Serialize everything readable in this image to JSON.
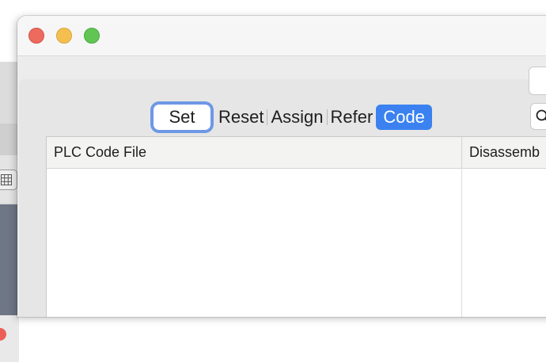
{
  "segmented": {
    "items": [
      {
        "label": "Set",
        "state": "focused"
      },
      {
        "label": "Reset",
        "state": "normal"
      },
      {
        "label": "Assign",
        "state": "normal"
      },
      {
        "label": "Refer",
        "state": "normal"
      },
      {
        "label": "Code",
        "state": "selected"
      }
    ],
    "accent_color": "#3b82f0",
    "focus_ring_color": "#6e98e6"
  },
  "table": {
    "columns": [
      "PLC Code File",
      "Disassemb"
    ]
  },
  "traffic_lights": {
    "close_color": "#ed6a5e",
    "minimize_color": "#f5bf4f",
    "zoom_color": "#61c554"
  },
  "icons": {
    "search": "search-icon",
    "grid": "grid-icon"
  }
}
